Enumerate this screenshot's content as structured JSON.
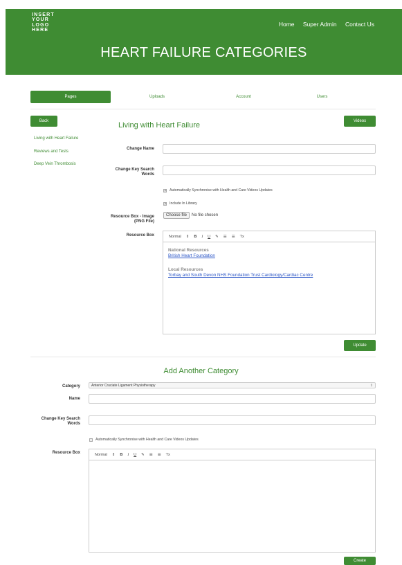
{
  "header": {
    "logo_lines": [
      "INSERT",
      "YOUR",
      "LOGO",
      "HERE"
    ],
    "nav": [
      "Home",
      "Super Admin",
      "Contact Us"
    ],
    "title": "HEART FAILURE CATEGORIES",
    "color": "#3f8c33"
  },
  "tabs": [
    "Pages",
    "Uploads",
    "Account",
    "Users"
  ],
  "buttons": {
    "back": "Back",
    "videos": "Videos",
    "update": "Update",
    "create": "Create"
  },
  "sidebar": {
    "items": [
      "Living with Heart Failure",
      "Reviews and Tests",
      "Deep Vein Thrombosis"
    ]
  },
  "edit_form": {
    "title": "Living with Heart Failure",
    "change_name_label": "Change Name",
    "change_keys_label": "Change Key Search Words",
    "sync_label": "Automatically Synchronise with Health and Care Videos Updates",
    "include_label": "Include In Library",
    "image_label": "Resource Box - Image (PNG File)",
    "choose_file": "Choose file",
    "no_file": "No file chosen",
    "resource_label": "Resource Box",
    "toolbar": {
      "normal": "Normal",
      "arrows": "⇕",
      "bold": "B",
      "italic": "I",
      "underline": "U",
      "link": "✎",
      "olist": "☰",
      "ulist": "☰",
      "clear": "Tx"
    },
    "resource": {
      "national_heading": "National Resources",
      "national_link": "British Heart Foundation",
      "local_heading": "Local Resources",
      "local_link": "Torbay and South Devon NHS Foundation Trust Cardiology/Cardiac Centre"
    }
  },
  "add_form": {
    "title": "Add Another Category",
    "category_label": "Category",
    "category_value": "Anterior Cruciate Ligament Physiotherapy",
    "name_label": "Name",
    "keys_label": "Change Key Search Words",
    "sync_label": "Automatically Synchronise with Health and Care Videos Updates",
    "resource_label": "Resource Box",
    "toolbar": {
      "normal": "Normal",
      "arrows": "⇕",
      "bold": "B",
      "italic": "I",
      "underline": "U",
      "link": "✎",
      "olist": "☰",
      "ulist": "☰",
      "clear": "Tx"
    }
  }
}
